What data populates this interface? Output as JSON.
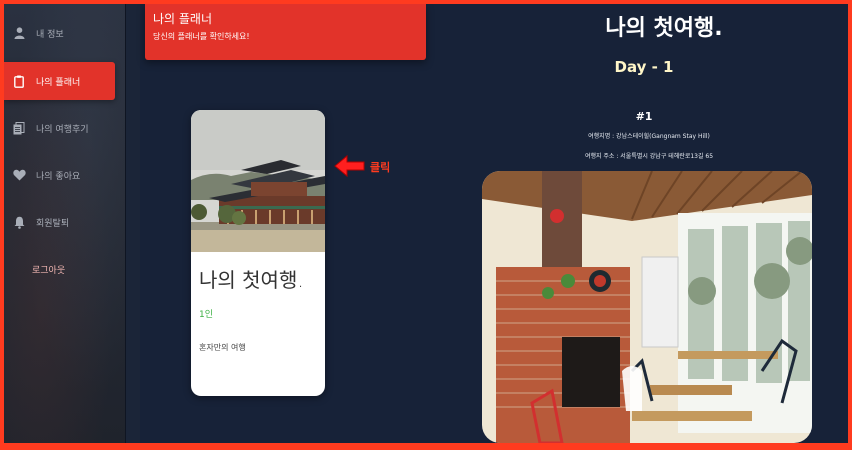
{
  "sidebar": {
    "items": [
      {
        "label": "내 정보",
        "icon": "user-icon"
      },
      {
        "label": "나의 플래너",
        "icon": "clipboard-icon"
      },
      {
        "label": "나의 여행후기",
        "icon": "documents-icon"
      },
      {
        "label": "나의 좋아요",
        "icon": "heart-icon"
      },
      {
        "label": "회원탈퇴",
        "icon": "bell-icon"
      }
    ],
    "logout_label": "로그아웃",
    "active_color": "#e2332a"
  },
  "header": {
    "title": "나의 플래너",
    "subtitle": "당신의 플래너를 확인하세요!"
  },
  "card": {
    "title": "나의 첫여행.",
    "count": "1인",
    "description": "혼자만의 여행"
  },
  "annotation": {
    "click_label": "클릭",
    "color": "#ff3b1f"
  },
  "trip": {
    "title": "나의 첫여행.",
    "day": "Day - 1",
    "number": "#1",
    "place_name": "여행지명 : 강남스테이힐(Gangnam Stay Hill)",
    "place_address": "여행지 주소 : 서울특별시 강남구 테헤란로13길 65"
  }
}
